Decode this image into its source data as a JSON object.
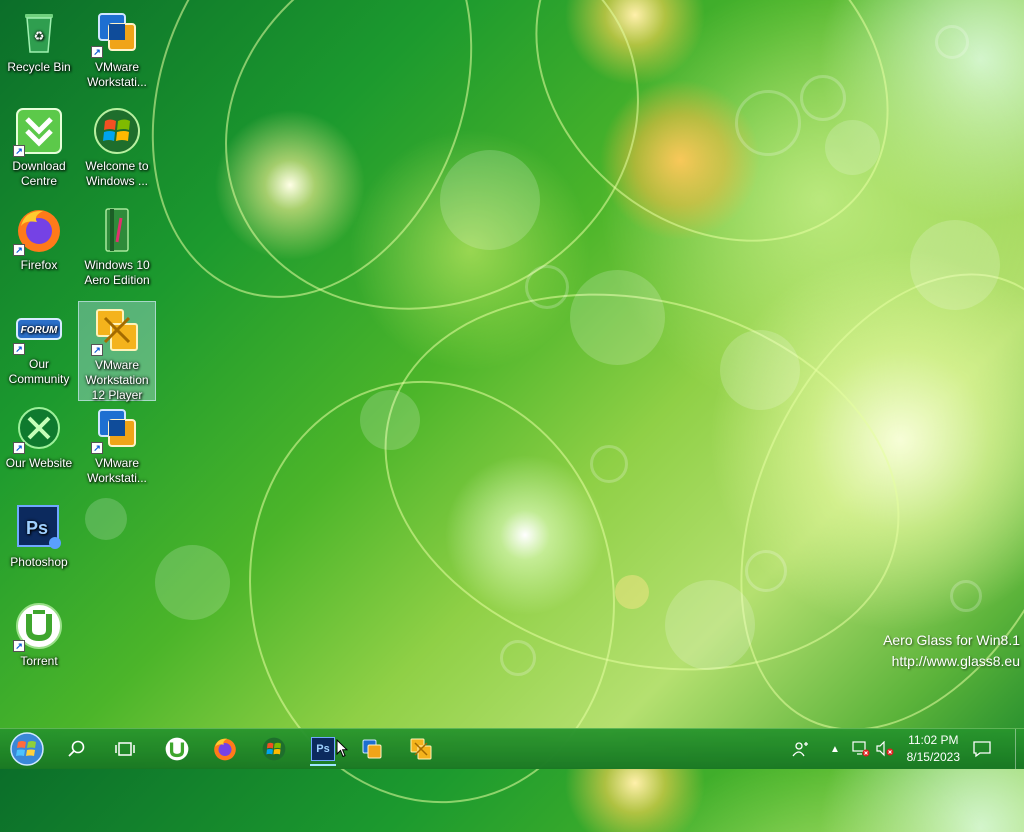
{
  "desktop": {
    "icons": [
      {
        "label": "Recycle Bin"
      },
      {
        "label": "VMware Workstati..."
      },
      {
        "label": "Download Centre"
      },
      {
        "label": "Welcome to Windows ..."
      },
      {
        "label": "Firefox"
      },
      {
        "label": "Windows 10 Aero Edition"
      },
      {
        "label": "Our Community",
        "badge": "FORUM"
      },
      {
        "label": "VMware Workstation 12 Player"
      },
      {
        "label": "Our Website"
      },
      {
        "label": "VMware Workstati..."
      },
      {
        "label": "Photoshop",
        "badge": "Ps"
      },
      {
        "label": "Torrent"
      }
    ]
  },
  "watermark": {
    "line1": "Aero Glass for Win8.1",
    "line2": "http://www.glass8.eu"
  },
  "taskbar": {
    "ps_badge": "Ps",
    "clock": {
      "time": "11:02 PM",
      "date": "8/15/2023"
    }
  },
  "colors": {
    "taskbar": "#1f8a2c",
    "accent": "#9ee6ff"
  }
}
